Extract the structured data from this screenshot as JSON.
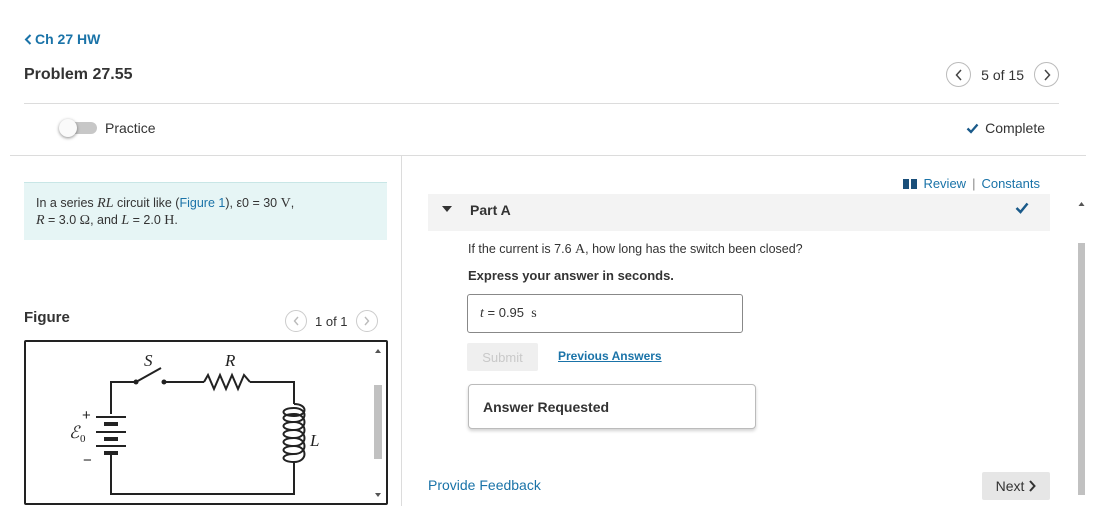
{
  "header": {
    "back_label": "Ch 27 HW",
    "problem_title": "Problem 27.55",
    "pager_text": "5 of 15"
  },
  "practice": {
    "label": "Practice",
    "enabled": false
  },
  "status": {
    "complete_label": "Complete"
  },
  "problem": {
    "t1": "In a series ",
    "rl": "RL",
    "t2": " circuit like (",
    "figure_link": "Figure 1",
    "t3": "), ",
    "emf": "ε0",
    "t4": " = 30 ",
    "v": "V",
    "t5": ",",
    "r": "R",
    "t6": " = 3.0 ",
    "ohm": "Ω",
    "t7": ", and ",
    "l": "L",
    "t8": " = 2.0 ",
    "h": "H",
    "t9": "."
  },
  "figure": {
    "heading": "Figure",
    "pager_text": "1 of 1",
    "labels": {
      "switch": "S",
      "resistor": "R",
      "inductor": "L",
      "emf": "ℰ",
      "emf_sub": "0",
      "plus": "+",
      "minus": "−"
    }
  },
  "links": {
    "review": "Review",
    "separator": "|",
    "constants": "Constants"
  },
  "part": {
    "title": "Part A",
    "q1": "If the current is 7.6 ",
    "q_unit": "A",
    "q2": ", how long has the switch been closed?",
    "instruction": "Express your answer in seconds.",
    "answer_var": "t",
    "answer_eq": " = ",
    "answer_value": "0.95",
    "answer_unit": "s",
    "submit_label": "Submit",
    "previous_answers_label": "Previous Answers",
    "answer_requested_label": "Answer Requested"
  },
  "footer": {
    "feedback_label": "Provide Feedback",
    "next_label": "Next"
  },
  "colors": {
    "link": "#1a73a8",
    "problem_bg": "#e6f5f5",
    "check": "#1a5a8a"
  }
}
